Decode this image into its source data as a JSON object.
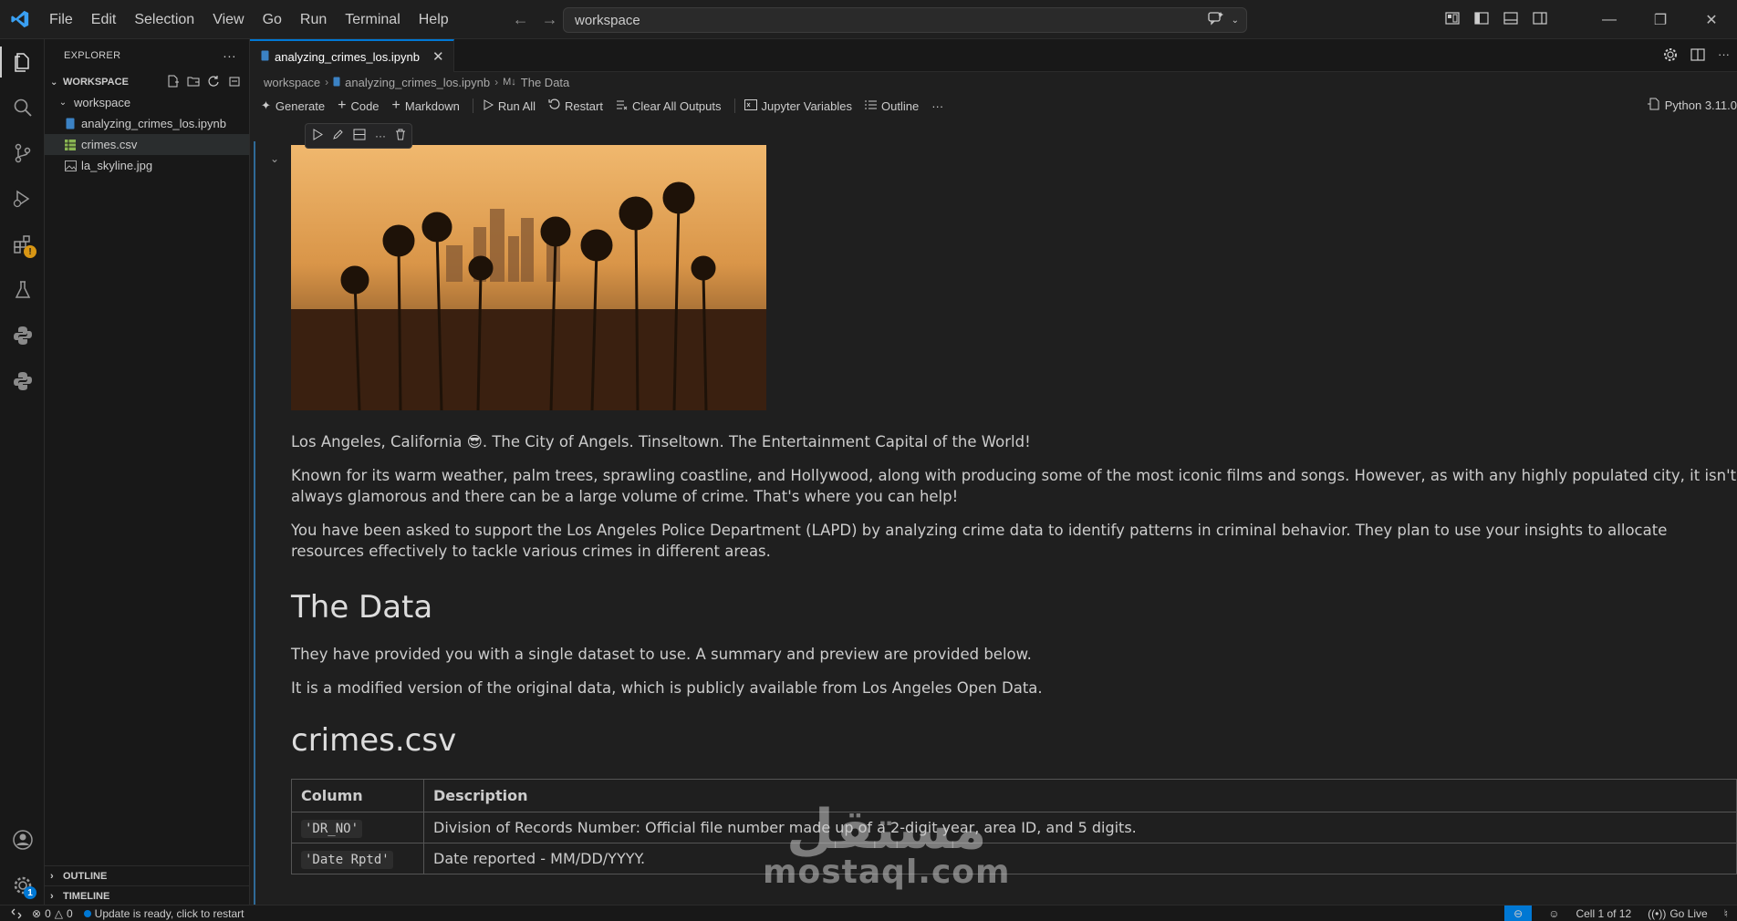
{
  "menu": [
    "File",
    "Edit",
    "Selection",
    "View",
    "Go",
    "Run",
    "Terminal",
    "Help"
  ],
  "command_center": {
    "text": "workspace"
  },
  "sidebar": {
    "title": "EXPLORER",
    "section": "WORKSPACE",
    "folder": "workspace",
    "files": [
      {
        "name": "analyzing_crimes_los.ipynb",
        "icon": "notebook-icon"
      },
      {
        "name": "crimes.csv",
        "icon": "csv-icon"
      },
      {
        "name": "la_skyline.jpg",
        "icon": "image-icon"
      }
    ],
    "outline": "OUTLINE",
    "timeline": "TIMELINE"
  },
  "tab": {
    "label": "analyzing_crimes_los.ipynb"
  },
  "breadcrumb": {
    "root": "workspace",
    "file": "analyzing_crimes_los.ipynb",
    "section_prefix": "M↓",
    "section": "The Data"
  },
  "toolbar": {
    "generate": "Generate",
    "code": "Code",
    "markdown": "Markdown",
    "run_all": "Run All",
    "restart": "Restart",
    "clear_outputs": "Clear All Outputs",
    "variables": "Jupyter Variables",
    "outline": "Outline",
    "more": "···",
    "kernel": "Python 3.11.0"
  },
  "content": {
    "p1": "Los Angeles, California 😎. The City of Angels. Tinseltown. The Entertainment Capital of the World!",
    "p2": "Known for its warm weather, palm trees, sprawling coastline, and Hollywood, along with producing some of the most iconic films and songs. However, as with any highly populated city, it isn't always glamorous and there can be a large volume of crime. That's where you can help!",
    "p3": "You have been asked to support the Los Angeles Police Department (LAPD) by analyzing crime data to identify patterns in criminal behavior. They plan to use your insights to allocate resources effectively to tackle various crimes in different areas.",
    "h_data": "The Data",
    "p4": "They have provided you with a single dataset to use. A summary and preview are provided below.",
    "p5": "It is a modified version of the original data, which is publicly available from Los Angeles Open Data.",
    "h_csv": "crimes.csv",
    "table": {
      "headers": [
        "Column",
        "Description"
      ],
      "rows": [
        [
          "'DR_NO'",
          "Division of Records Number: Official file number made up of a 2-digit year, area ID, and 5 digits."
        ],
        [
          "'Date Rptd'",
          "Date reported - MM/DD/YYYY."
        ]
      ]
    }
  },
  "watermark": {
    "arabic": "مستقل",
    "latin": "mostaql.com"
  },
  "status": {
    "errors": "0",
    "warnings": "0",
    "update": "Update is ready, click to restart",
    "cell": "Cell 1 of 12",
    "golive": "Go Live"
  }
}
